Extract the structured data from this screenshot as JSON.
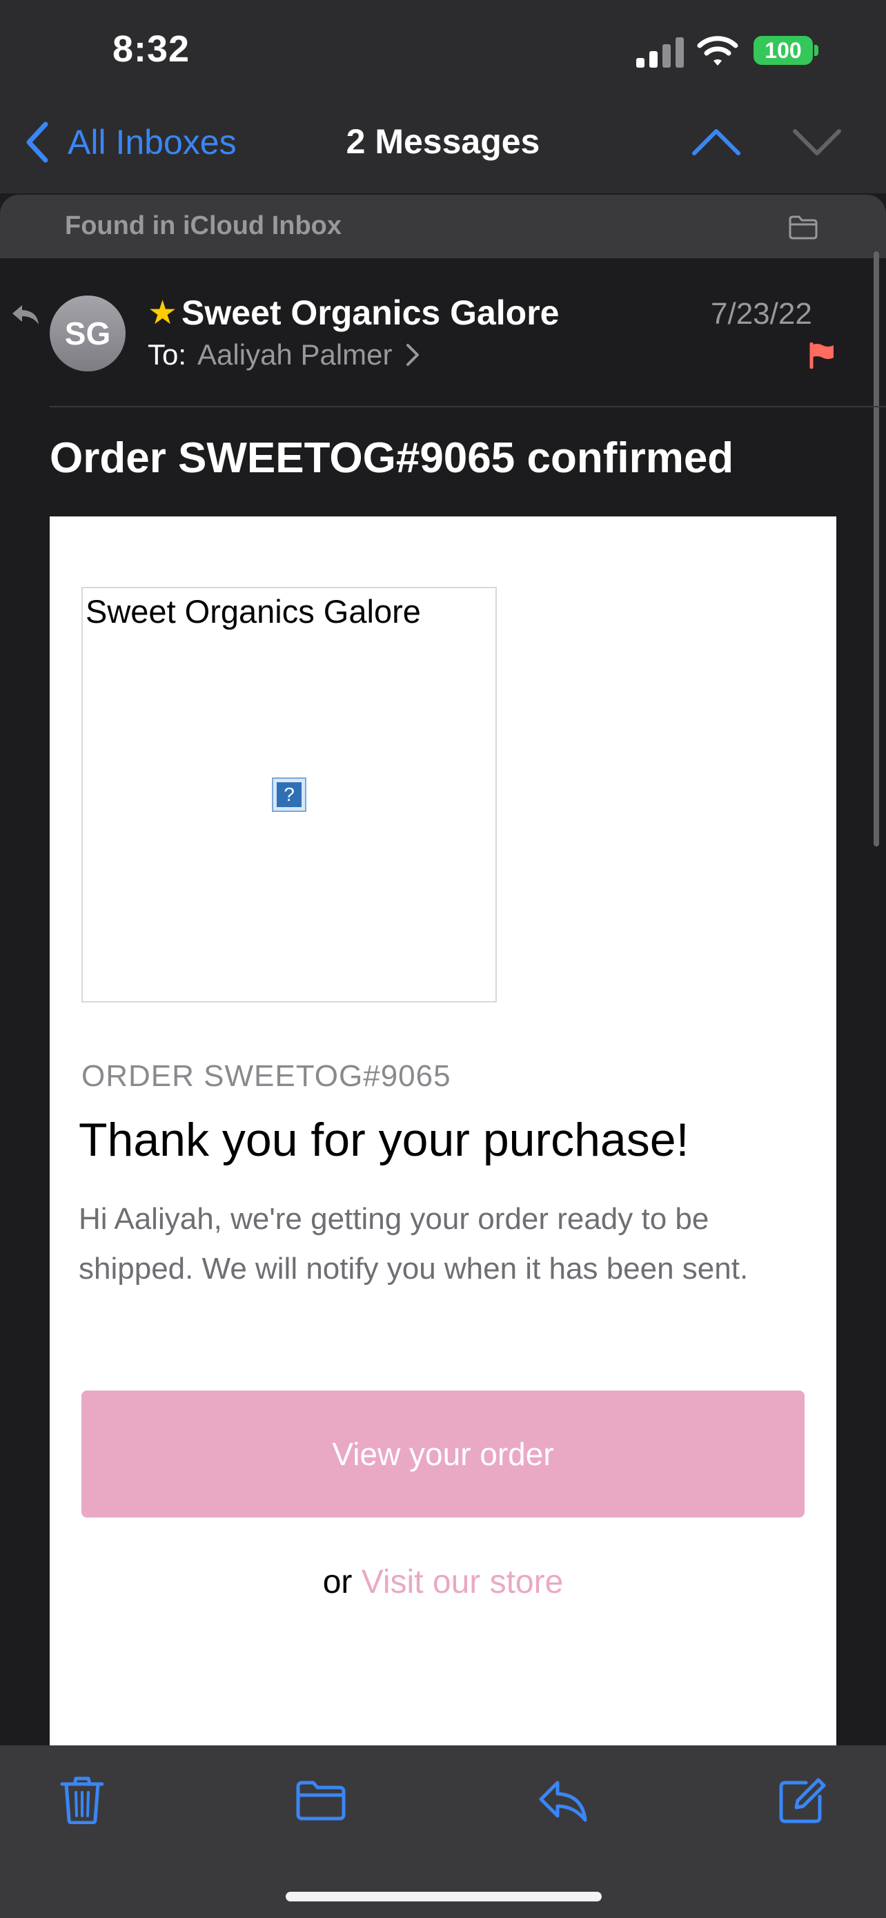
{
  "status_bar": {
    "time": "8:32",
    "battery": "100"
  },
  "nav": {
    "back_label": "All Inboxes",
    "title": "2 Messages"
  },
  "found_in": "Found in iCloud Inbox",
  "message_header": {
    "avatar_initials": "SG",
    "sender": "Sweet Organics Galore",
    "to_label": "To:",
    "to_name": "Aaliyah Palmer",
    "date": "7/23/22",
    "subject": "Order SWEETOG#9065 confirmed"
  },
  "email": {
    "logo_alt_text": "Sweet Organics Galore",
    "broken_image_glyph": "?",
    "order_label": "ORDER SWEETOG#9065",
    "heading": "Thank you for your purchase!",
    "message": "Hi Aaliyah, we're getting your order ready to be shipped. We will notify you when it has been sent.",
    "button_label": "View your order",
    "or_text": "or",
    "link_text": "Visit our store"
  },
  "colors": {
    "accent": "#3a86f6",
    "brand_pink": "#e9a9c5",
    "flag": "#ff6b5e",
    "star": "#ffcc00",
    "battery": "#34c759"
  },
  "icons": {
    "back": "chevron-left-icon",
    "up": "chevron-up-icon",
    "down": "chevron-down-icon",
    "trash": "trash-icon",
    "folder": "folder-icon",
    "reply": "reply-icon",
    "compose": "compose-icon"
  }
}
